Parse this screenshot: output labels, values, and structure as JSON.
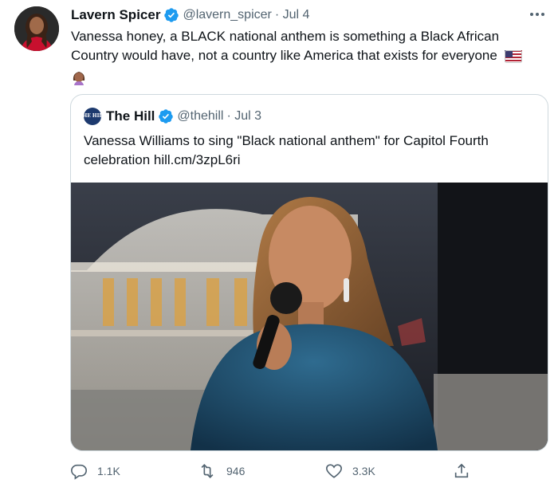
{
  "tweet": {
    "author": {
      "name": "Lavern Spicer",
      "handle": "@lavern_spicer",
      "date": "· Jul 4"
    },
    "text": "Vanessa honey, a BLACK national anthem is something a Black African Country would have, not a country like America that exists for everyone",
    "emojis": [
      "us-flag-emoji",
      "woman-facepalming-emoji"
    ],
    "quoted": {
      "author": {
        "name": "The Hill",
        "handle": "@thehill",
        "date": "· Jul 3",
        "avatar_text": "THE HILL"
      },
      "text": "Vanessa Williams to sing \"Black national anthem\" for Capitol Fourth celebration hill.cm/3zpL6ri",
      "image": "woman-singing-at-capitol-photo"
    },
    "actions": {
      "reply_count": "1.1K",
      "retweet_count": "946",
      "like_count": "3.3K"
    }
  },
  "colors": {
    "text_primary": "#0f1419",
    "text_secondary": "#536471",
    "verified_blue": "#1d9bf0",
    "border": "#cfd9de"
  }
}
